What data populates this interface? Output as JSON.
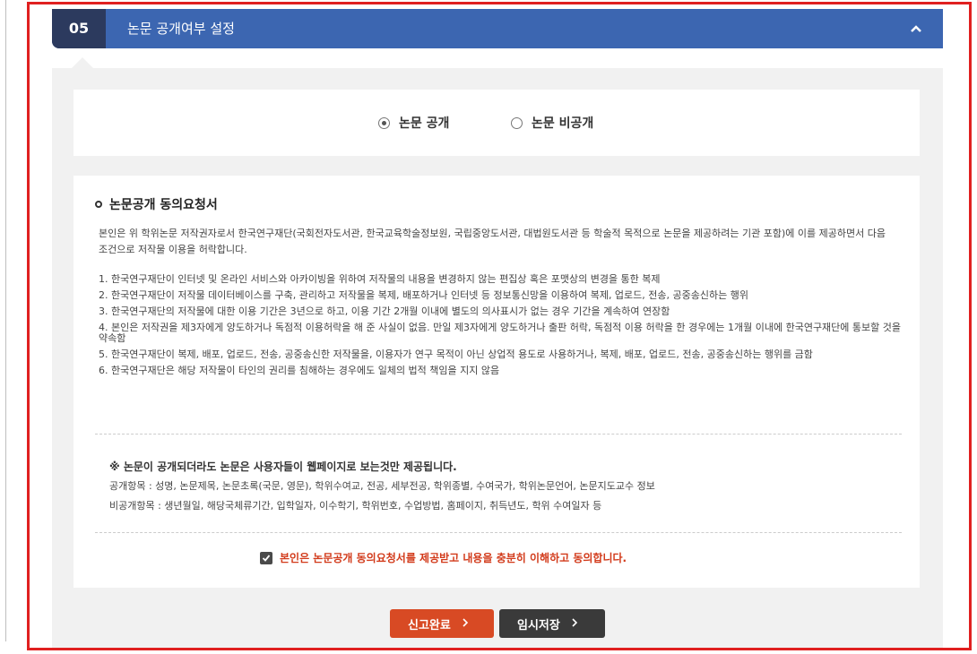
{
  "header": {
    "step": "05",
    "title": "논문 공개여부 설정"
  },
  "visibility": {
    "options": [
      {
        "label": "논문 공개",
        "selected": true
      },
      {
        "label": "논문 비공개",
        "selected": false
      }
    ]
  },
  "consent": {
    "title": "논문공개 동의요청서",
    "intro": "본인은 위 학위논문 저작권자로서 한국연구재단(국회전자도서관, 한국교육학술정보원, 국립중앙도서관, 대법원도서관 등 학술적 목적으로 논문을 제공하려는 기관 포함)에 이를 제공하면서 다음 조건으로 저작물 이용을 허락합니다.",
    "terms": [
      "1. 한국연구재단이 인터넷 및 온라인 서비스와 아카이빙을 위하여 저작물의 내용을 변경하지 않는 편집상 혹은 포맷상의 변경을 통한 복제",
      "2. 한국연구재단이 저작물 데이터베이스를 구축, 관리하고 저작물을 복제, 배포하거나 인터넷 등 정보통신망을 이용하여 복제, 업로드, 전송, 공중송신하는 행위",
      "3. 한국연구재단의 저작물에 대한 이용 기간은 3년으로 하고, 이용 기간 2개월 이내에 별도의 의사표시가 없는 경우 기간을 계속하여 연장함",
      "4. 본인은 저작권을 제3자에게 양도하거나 독점적 이용허락을 해 준 사실이 없음. 만일 제3자에게 양도하거나 출판 허락, 독점적 이용 허락을 한 경우에는 1개월 이내에 한국연구재단에 통보할 것을 약속함",
      "5. 한국연구재단이 복제, 배포, 업로드, 전송, 공중송신한 저작물을, 이용자가 연구 목적이 아닌 상업적 용도로 사용하거나, 복제, 배포, 업로드, 전송, 공중송신하는 행위를 금함",
      "6. 한국연구재단은 해당 저작물이 타인의 권리를 침해하는 경우에도 일체의 법적 책임을 지지 않음"
    ],
    "note_title": "※ 논문이 공개되더라도 논문은 사용자들이 웹페이지로 보는것만 제공됩니다.",
    "public_items": "공개항목 : 성명, 논문제목, 논문초록(국문, 영문), 학위수여교, 전공, 세부전공, 학위종별, 수여국가, 학위논문언어, 논문지도교수 정보",
    "private_items": "비공개항목 : 생년월일, 해당국체류기간, 입학일자, 이수학기, 학위번호, 수업방법, 홈페이지, 취득년도, 학위 수여일자 등",
    "agree_label": "본인은 논문공개 동의요청서를 제공받고 내용을 충분히 이해하고 동의합니다.",
    "agree_checked": true
  },
  "buttons": {
    "submit": "신고완료",
    "temp_save": "임시저장"
  },
  "colors": {
    "header_bg": "#3c66b1",
    "step_bg": "#2c3a5e",
    "submit_bg": "#d84a24",
    "save_bg": "#3a3a3a",
    "agree_text": "#d23a1a",
    "frame": "#e02020"
  }
}
